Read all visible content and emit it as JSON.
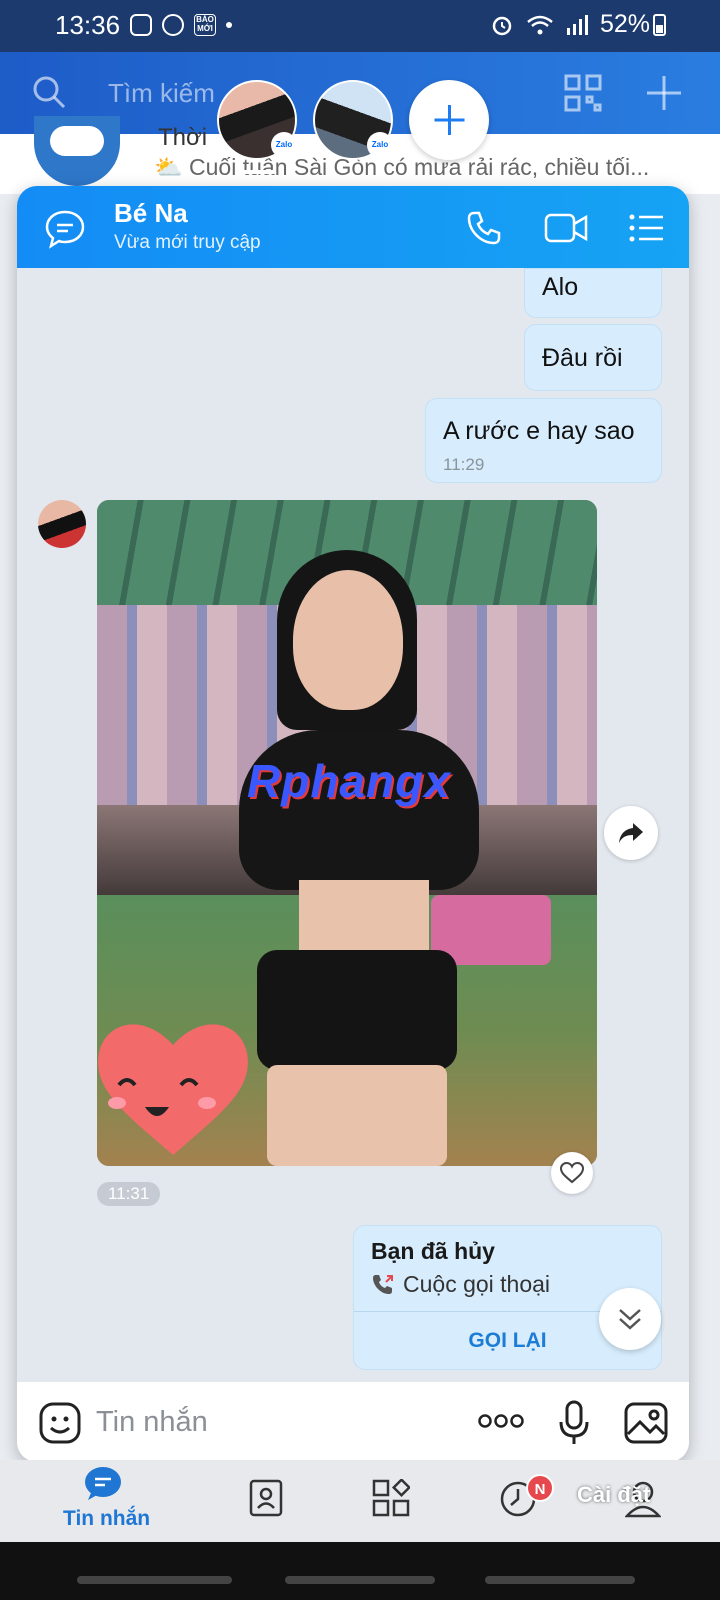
{
  "status_bar": {
    "time": "13:36",
    "baomoi": "BÁO MỚI",
    "battery": "52%"
  },
  "background_app": {
    "search_placeholder": "Tìm kiếm",
    "conversation_title_fragment": "Thời",
    "conversation_preview": "⛅ Cuối tuần Sài Gòn có mưa rải rác, chiều tối..."
  },
  "bubble_heads": [
    {
      "badge": "Zalo"
    },
    {
      "badge": "Zalo"
    }
  ],
  "chat": {
    "contact_name": "Bé Na",
    "contact_status": "Vừa mới truy cập",
    "messages": [
      {
        "text": "Alo"
      },
      {
        "text": "Đâu rồi"
      },
      {
        "text": "A rước e hay sao",
        "time": "11:29"
      }
    ],
    "photo": {
      "watermark": "Rphangx",
      "time": "11:31"
    },
    "call_card": {
      "title": "Bạn đã hủy",
      "subtitle": "Cuộc gọi thoại",
      "action": "GỌI LẠI"
    },
    "composer_placeholder": "Tin nhắn"
  },
  "bottom_nav": {
    "messages_label": "Tin nhắn",
    "timeline_badge": "N",
    "settings_label": "Cài đặt"
  },
  "colors": {
    "header_blue": "#148cf5",
    "accent": "#1d7cd6",
    "sent_bubble": "#d7edfd",
    "badge_red": "#e5484d"
  }
}
